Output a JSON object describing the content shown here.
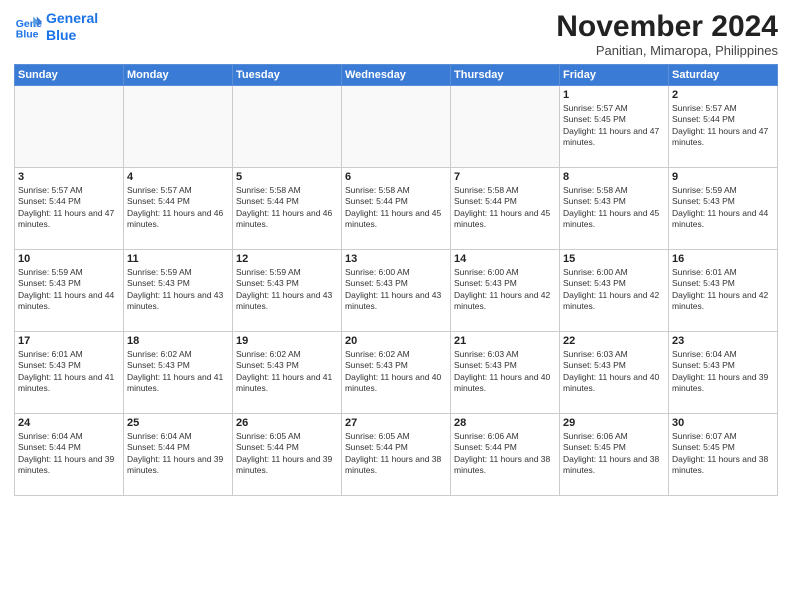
{
  "logo": {
    "line1": "General",
    "line2": "Blue"
  },
  "title": "November 2024",
  "subtitle": "Panitian, Mimaropa, Philippines",
  "weekdays": [
    "Sunday",
    "Monday",
    "Tuesday",
    "Wednesday",
    "Thursday",
    "Friday",
    "Saturday"
  ],
  "weeks": [
    [
      {
        "day": "",
        "info": ""
      },
      {
        "day": "",
        "info": ""
      },
      {
        "day": "",
        "info": ""
      },
      {
        "day": "",
        "info": ""
      },
      {
        "day": "",
        "info": ""
      },
      {
        "day": "1",
        "info": "Sunrise: 5:57 AM\nSunset: 5:45 PM\nDaylight: 11 hours and 47 minutes."
      },
      {
        "day": "2",
        "info": "Sunrise: 5:57 AM\nSunset: 5:44 PM\nDaylight: 11 hours and 47 minutes."
      }
    ],
    [
      {
        "day": "3",
        "info": "Sunrise: 5:57 AM\nSunset: 5:44 PM\nDaylight: 11 hours and 47 minutes."
      },
      {
        "day": "4",
        "info": "Sunrise: 5:57 AM\nSunset: 5:44 PM\nDaylight: 11 hours and 46 minutes."
      },
      {
        "day": "5",
        "info": "Sunrise: 5:58 AM\nSunset: 5:44 PM\nDaylight: 11 hours and 46 minutes."
      },
      {
        "day": "6",
        "info": "Sunrise: 5:58 AM\nSunset: 5:44 PM\nDaylight: 11 hours and 45 minutes."
      },
      {
        "day": "7",
        "info": "Sunrise: 5:58 AM\nSunset: 5:44 PM\nDaylight: 11 hours and 45 minutes."
      },
      {
        "day": "8",
        "info": "Sunrise: 5:58 AM\nSunset: 5:43 PM\nDaylight: 11 hours and 45 minutes."
      },
      {
        "day": "9",
        "info": "Sunrise: 5:59 AM\nSunset: 5:43 PM\nDaylight: 11 hours and 44 minutes."
      }
    ],
    [
      {
        "day": "10",
        "info": "Sunrise: 5:59 AM\nSunset: 5:43 PM\nDaylight: 11 hours and 44 minutes."
      },
      {
        "day": "11",
        "info": "Sunrise: 5:59 AM\nSunset: 5:43 PM\nDaylight: 11 hours and 43 minutes."
      },
      {
        "day": "12",
        "info": "Sunrise: 5:59 AM\nSunset: 5:43 PM\nDaylight: 11 hours and 43 minutes."
      },
      {
        "day": "13",
        "info": "Sunrise: 6:00 AM\nSunset: 5:43 PM\nDaylight: 11 hours and 43 minutes."
      },
      {
        "day": "14",
        "info": "Sunrise: 6:00 AM\nSunset: 5:43 PM\nDaylight: 11 hours and 42 minutes."
      },
      {
        "day": "15",
        "info": "Sunrise: 6:00 AM\nSunset: 5:43 PM\nDaylight: 11 hours and 42 minutes."
      },
      {
        "day": "16",
        "info": "Sunrise: 6:01 AM\nSunset: 5:43 PM\nDaylight: 11 hours and 42 minutes."
      }
    ],
    [
      {
        "day": "17",
        "info": "Sunrise: 6:01 AM\nSunset: 5:43 PM\nDaylight: 11 hours and 41 minutes."
      },
      {
        "day": "18",
        "info": "Sunrise: 6:02 AM\nSunset: 5:43 PM\nDaylight: 11 hours and 41 minutes."
      },
      {
        "day": "19",
        "info": "Sunrise: 6:02 AM\nSunset: 5:43 PM\nDaylight: 11 hours and 41 minutes."
      },
      {
        "day": "20",
        "info": "Sunrise: 6:02 AM\nSunset: 5:43 PM\nDaylight: 11 hours and 40 minutes."
      },
      {
        "day": "21",
        "info": "Sunrise: 6:03 AM\nSunset: 5:43 PM\nDaylight: 11 hours and 40 minutes."
      },
      {
        "day": "22",
        "info": "Sunrise: 6:03 AM\nSunset: 5:43 PM\nDaylight: 11 hours and 40 minutes."
      },
      {
        "day": "23",
        "info": "Sunrise: 6:04 AM\nSunset: 5:43 PM\nDaylight: 11 hours and 39 minutes."
      }
    ],
    [
      {
        "day": "24",
        "info": "Sunrise: 6:04 AM\nSunset: 5:44 PM\nDaylight: 11 hours and 39 minutes."
      },
      {
        "day": "25",
        "info": "Sunrise: 6:04 AM\nSunset: 5:44 PM\nDaylight: 11 hours and 39 minutes."
      },
      {
        "day": "26",
        "info": "Sunrise: 6:05 AM\nSunset: 5:44 PM\nDaylight: 11 hours and 39 minutes."
      },
      {
        "day": "27",
        "info": "Sunrise: 6:05 AM\nSunset: 5:44 PM\nDaylight: 11 hours and 38 minutes."
      },
      {
        "day": "28",
        "info": "Sunrise: 6:06 AM\nSunset: 5:44 PM\nDaylight: 11 hours and 38 minutes."
      },
      {
        "day": "29",
        "info": "Sunrise: 6:06 AM\nSunset: 5:45 PM\nDaylight: 11 hours and 38 minutes."
      },
      {
        "day": "30",
        "info": "Sunrise: 6:07 AM\nSunset: 5:45 PM\nDaylight: 11 hours and 38 minutes."
      }
    ]
  ]
}
